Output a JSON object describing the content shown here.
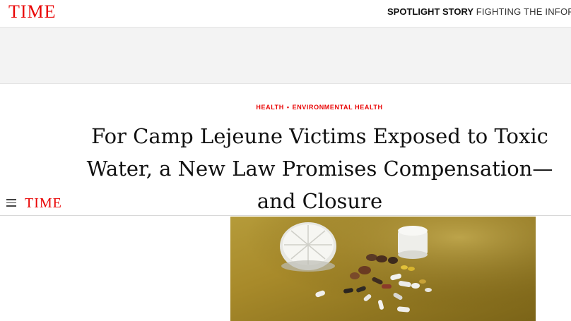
{
  "brand": {
    "logo_text": "TIME",
    "brand_color": "#e90606"
  },
  "spotlight": {
    "label": "SPOTLIGHT STORY",
    "text": "FIGHTING THE INFORMAT"
  },
  "nav": {
    "logo_text": "TIME",
    "menu_icon": "hamburger-menu-icon"
  },
  "article": {
    "section": "HEALTH",
    "separator": "•",
    "subsection": "ENVIRONMENTAL HEALTH",
    "headline": "For Camp Lejeune Victims Exposed to Toxic Water, a New Law Promises Compensation—and Closure"
  }
}
